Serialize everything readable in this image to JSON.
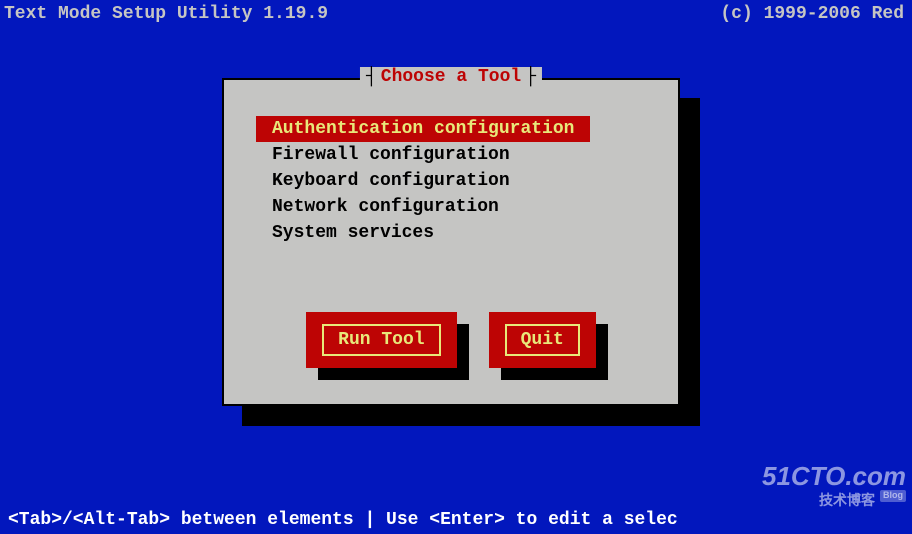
{
  "header": {
    "title": "Text Mode Setup Utility 1.19.9",
    "copyright": "(c) 1999-2006 Red"
  },
  "dialog": {
    "title": "Choose a Tool",
    "items": [
      {
        "label": "Authentication configuration",
        "selected": true
      },
      {
        "label": "Firewall configuration",
        "selected": false
      },
      {
        "label": "Keyboard configuration",
        "selected": false
      },
      {
        "label": "Network configuration",
        "selected": false
      },
      {
        "label": "System services",
        "selected": false
      }
    ],
    "buttons": {
      "run": "Run Tool",
      "quit": "Quit"
    }
  },
  "footer": {
    "text": "  <Tab>/<Alt-Tab> between elements   |     Use <Enter> to edit a selec"
  },
  "watermark": {
    "main": "51CTO.com",
    "sub": "技术博客",
    "badge": "Blog"
  },
  "colors": {
    "background": "#0217bd",
    "panel": "#c5c5c3",
    "highlight_bg": "#bd0404",
    "highlight_fg": "#e8e87a"
  }
}
